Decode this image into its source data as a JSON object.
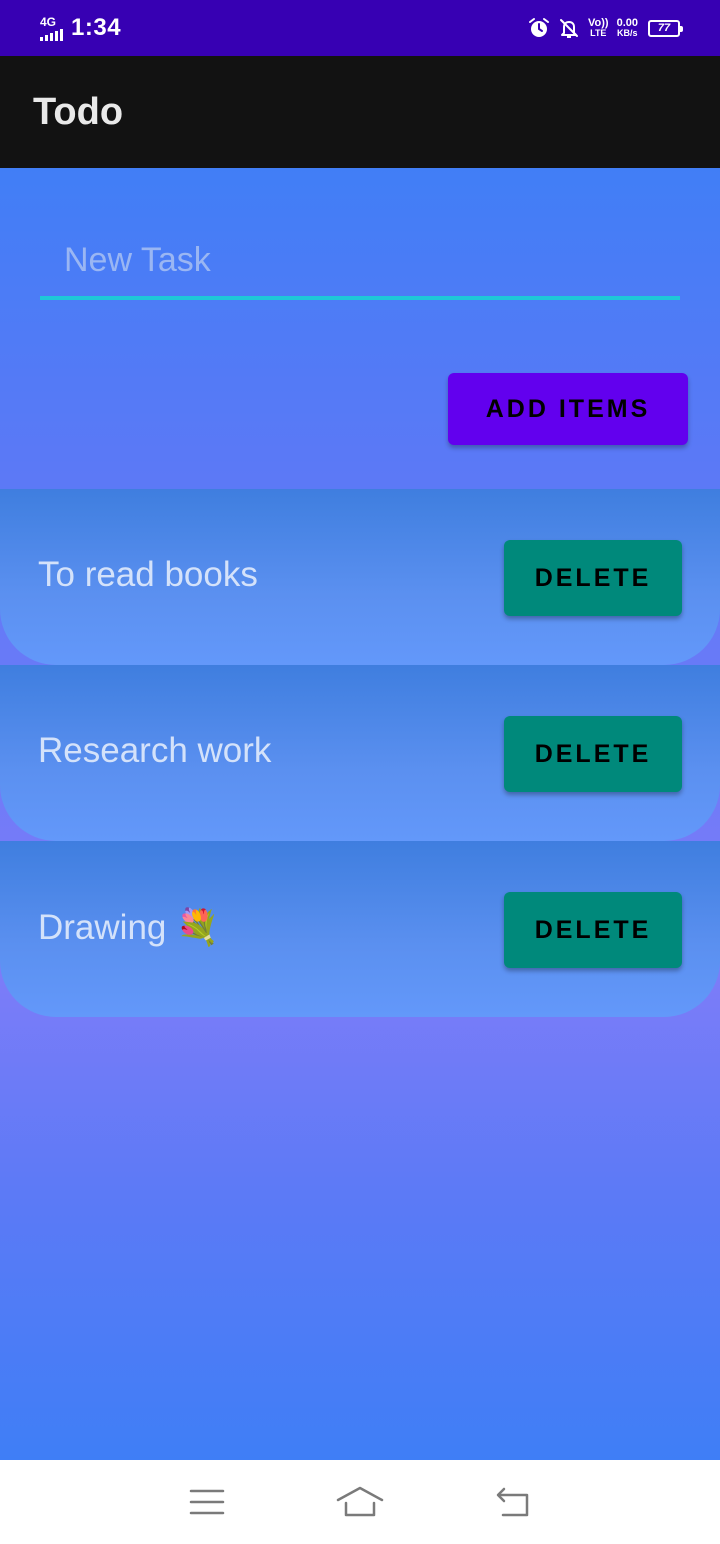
{
  "status_bar": {
    "network": "4G",
    "time": "1:34",
    "volte_top": "Vo))",
    "volte_bottom": "LTE",
    "speed_value": "0.00",
    "speed_unit": "KB/s",
    "battery_level": "77",
    "icons": [
      "signal-icon",
      "alarm-icon",
      "notifications-off-icon",
      "battery-icon"
    ]
  },
  "app_bar": {
    "title": "Todo"
  },
  "new_task": {
    "placeholder": "New Task",
    "value": ""
  },
  "add_button": {
    "label": "ADD ITEMS"
  },
  "tasks": [
    {
      "text": "To read books",
      "delete_label": "DELETE"
    },
    {
      "text": "Research work",
      "delete_label": "DELETE"
    },
    {
      "text": "Drawing 💐",
      "delete_label": "DELETE"
    }
  ],
  "nav_bar": {
    "icons": [
      "menu-icon",
      "home-icon",
      "back-icon"
    ]
  },
  "colors": {
    "status_bar": "#3700b3",
    "app_bar": "#121212",
    "accent_purple": "#6200ee",
    "delete_teal": "#00897b",
    "input_underline": "#1ec8d8"
  }
}
